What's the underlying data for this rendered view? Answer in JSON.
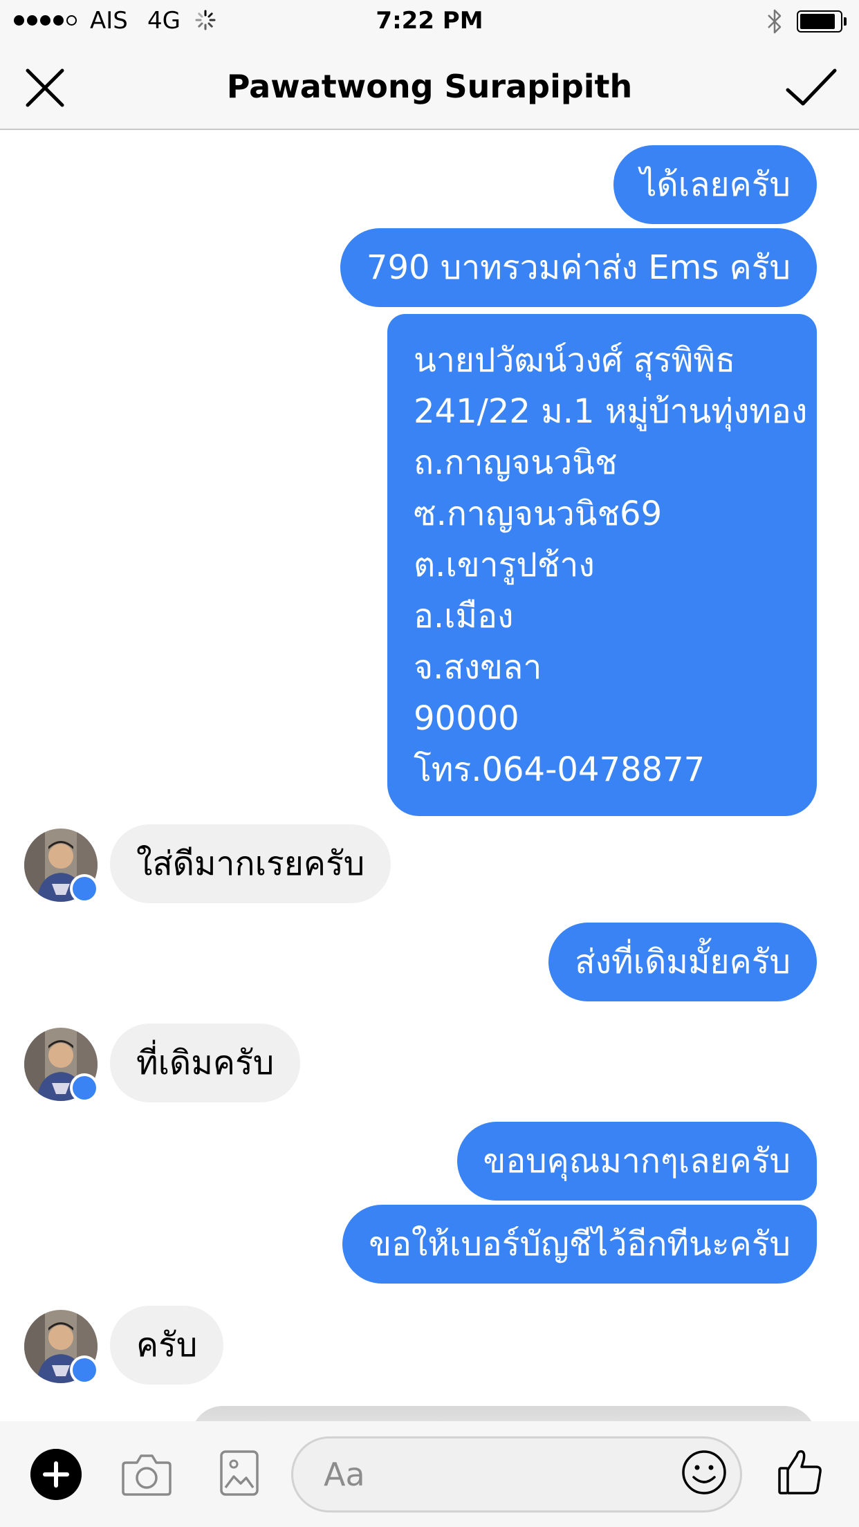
{
  "status_bar": {
    "carrier": "AIS",
    "network": "4G",
    "time": "7:22 PM",
    "signal_bars_filled": 4,
    "signal_bars_total": 5,
    "battery_level": 0.9
  },
  "header": {
    "title": "Pawatwong Surapipith",
    "close_icon": "close-icon",
    "done_icon": "checkmark-icon"
  },
  "messages": [
    {
      "direction": "outgoing",
      "text": "ได้เลยครับ"
    },
    {
      "direction": "outgoing",
      "text": "790 บาทรวมค่าส่ง Ems ครับ"
    },
    {
      "direction": "outgoing",
      "lines": [
        "นายปวัฒน์วงศ์ สุรพิพิธ",
        "241/22 ม.1 หมู่บ้านทุ่งทอง",
        "ถ.กาญจนวนิช",
        "ซ.กาญจนวนิช69",
        "ต.เขารูปช้าง",
        "อ.เมือง",
        "จ.สงขลา",
        "90000",
        "โทร.064-0478877"
      ]
    },
    {
      "direction": "incoming",
      "text": "ใส่ดีมากเรยครับ"
    },
    {
      "direction": "outgoing",
      "text": "ส่งที่เดิมมั้ยครับ"
    },
    {
      "direction": "incoming",
      "text": "ที่เดิมครับ"
    },
    {
      "direction": "outgoing",
      "text": "ขอบคุณมากๆเลยครับ"
    },
    {
      "direction": "outgoing",
      "text": "ขอให้เบอร์บัญชีไว้อีกทีนะครับ"
    },
    {
      "direction": "incoming",
      "text": "ครับ"
    }
  ],
  "composer": {
    "placeholder": "Aa",
    "icons": [
      "plus-icon",
      "camera-icon",
      "photo-icon",
      "emoji-icon",
      "thumbs-up-icon"
    ]
  },
  "colors": {
    "outgoing_bubble": "#3a83f4",
    "incoming_bubble": "#f0f0f0",
    "bar_background": "#f7f7f7"
  }
}
